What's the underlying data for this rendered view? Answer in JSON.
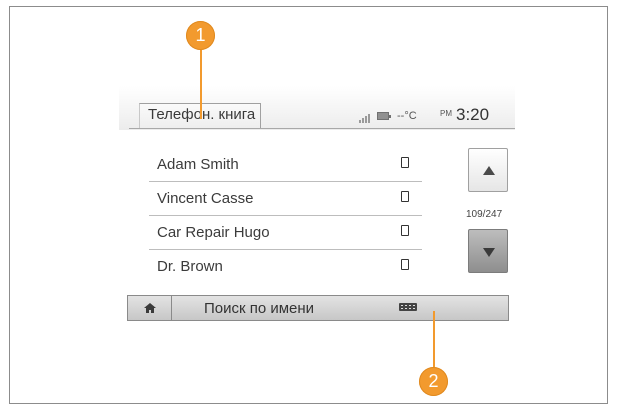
{
  "header": {
    "title": "Телефон. книга",
    "temperature": "--°C",
    "am_pm": "PM",
    "time": "3:20"
  },
  "contacts": [
    {
      "name": "Adam Smith"
    },
    {
      "name": "Vincent Casse"
    },
    {
      "name": "Car Repair Hugo"
    },
    {
      "name": "Dr. Brown"
    }
  ],
  "pagination": {
    "counter": "109/247"
  },
  "bottom_bar": {
    "search_label": "Поиск по имени"
  },
  "callouts": [
    "1",
    "2"
  ],
  "icons": {
    "signal": "signal-strength-icon",
    "battery": "battery-icon",
    "phone": "phone-icon",
    "home": "home-icon",
    "keyboard": "keyboard-icon",
    "scroll_up": "arrow-up-icon",
    "scroll_down": "arrow-down-icon"
  },
  "colors": {
    "callout": "#f29a2e"
  }
}
